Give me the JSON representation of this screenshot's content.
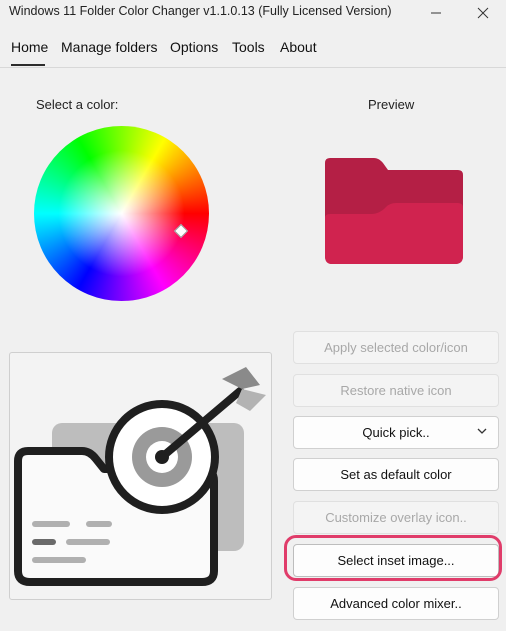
{
  "window": {
    "title": "Windows 11 Folder Color Changer v1.1.0.13 (Fully Licensed Version)",
    "minimize_icon": "minimize-icon",
    "close_icon": "close-icon"
  },
  "menu": {
    "items": [
      "Home",
      "Manage folders",
      "Options",
      "Tools",
      "About"
    ],
    "active": "Home"
  },
  "color_section": {
    "label": "Select a color:"
  },
  "preview_section": {
    "label": "Preview",
    "folder_color": "#d0234f",
    "folder_back_color": "#b41f45"
  },
  "buttons": {
    "apply": "Apply selected color/icon",
    "restore": "Restore native icon",
    "quick_pick": "Quick pick..",
    "set_default": "Set as default color",
    "customize_overlay": "Customize overlay icon..",
    "select_inset": "Select inset image...",
    "advanced_mixer": "Advanced color mixer.."
  },
  "highlight_color": "#e03c6a"
}
